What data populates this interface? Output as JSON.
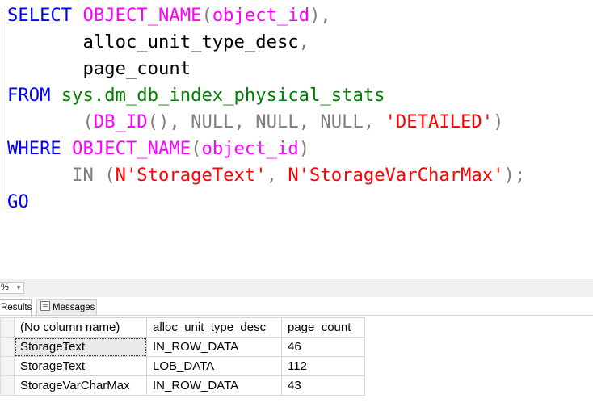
{
  "editor": {
    "lines": [
      [
        {
          "c": "kw",
          "t": "SELECT"
        },
        {
          "c": "",
          "t": " "
        },
        {
          "c": "fn",
          "t": "OBJECT_NAME"
        },
        {
          "c": "gr",
          "t": "("
        },
        {
          "c": "fn",
          "t": "object_id"
        },
        {
          "c": "gr",
          "t": "),"
        }
      ],
      [
        {
          "c": "",
          "t": "       alloc_unit_type_desc"
        },
        {
          "c": "gr",
          "t": ","
        }
      ],
      [
        {
          "c": "",
          "t": "       page_count"
        }
      ],
      [
        {
          "c": "kw",
          "t": "FROM"
        },
        {
          "c": "",
          "t": " "
        },
        {
          "c": "sys",
          "t": "sys.dm_db_index_physical_stats"
        }
      ],
      [
        {
          "c": "",
          "t": "       "
        },
        {
          "c": "gr",
          "t": "("
        },
        {
          "c": "fn",
          "t": "DB_ID"
        },
        {
          "c": "gr",
          "t": "(), NULL, NULL, NULL, "
        },
        {
          "c": "str",
          "t": "'DETAILED'"
        },
        {
          "c": "gr",
          "t": ")"
        }
      ],
      [
        {
          "c": "kw",
          "t": "WHERE"
        },
        {
          "c": "",
          "t": " "
        },
        {
          "c": "fn",
          "t": "OBJECT_NAME"
        },
        {
          "c": "gr",
          "t": "("
        },
        {
          "c": "fn",
          "t": "object_id"
        },
        {
          "c": "gr",
          "t": ")"
        }
      ],
      [
        {
          "c": "",
          "t": "      "
        },
        {
          "c": "gr",
          "t": "IN ("
        },
        {
          "c": "str",
          "t": "N'StorageText'"
        },
        {
          "c": "gr",
          "t": ", "
        },
        {
          "c": "str",
          "t": "N'StorageVarCharMax'"
        },
        {
          "c": "gr",
          "t": ");"
        }
      ],
      [
        {
          "c": "kw",
          "t": "GO"
        }
      ]
    ]
  },
  "zoom": {
    "value": "%"
  },
  "tabs": {
    "results": "Results",
    "messages": "Messages"
  },
  "grid": {
    "columns": [
      "(No column name)",
      "alloc_unit_type_desc",
      "page_count"
    ],
    "rows": [
      [
        "StorageText",
        "IN_ROW_DATA",
        "46"
      ],
      [
        "StorageText",
        "LOB_DATA",
        "112"
      ],
      [
        "StorageVarCharMax",
        "IN_ROW_DATA",
        "43"
      ]
    ]
  }
}
